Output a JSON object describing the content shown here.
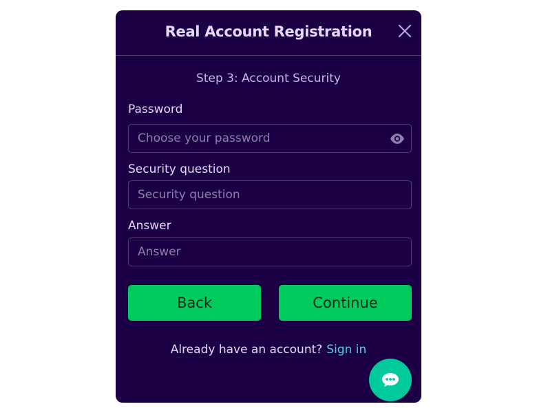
{
  "modal": {
    "title": "Real Account Registration",
    "step_label": "Step 3: Account Security"
  },
  "form": {
    "password": {
      "label": "Password",
      "placeholder": "Choose your password",
      "value": ""
    },
    "security_question": {
      "label": "Security question",
      "placeholder": "Security question",
      "value": ""
    },
    "answer": {
      "label": "Answer",
      "placeholder": "Answer",
      "value": ""
    }
  },
  "buttons": {
    "back": "Back",
    "continue": "Continue"
  },
  "footer": {
    "prompt": "Already have an account?",
    "signin_link": "Sign in"
  },
  "colors": {
    "modal_bg": "#1c0045",
    "accent_green": "#00cc5d",
    "link": "#4fd1d6",
    "chat_button": "#00c99c"
  },
  "icons": {
    "close": "close-icon",
    "show_password": "eye-icon",
    "chat": "chat-bubble-icon"
  }
}
